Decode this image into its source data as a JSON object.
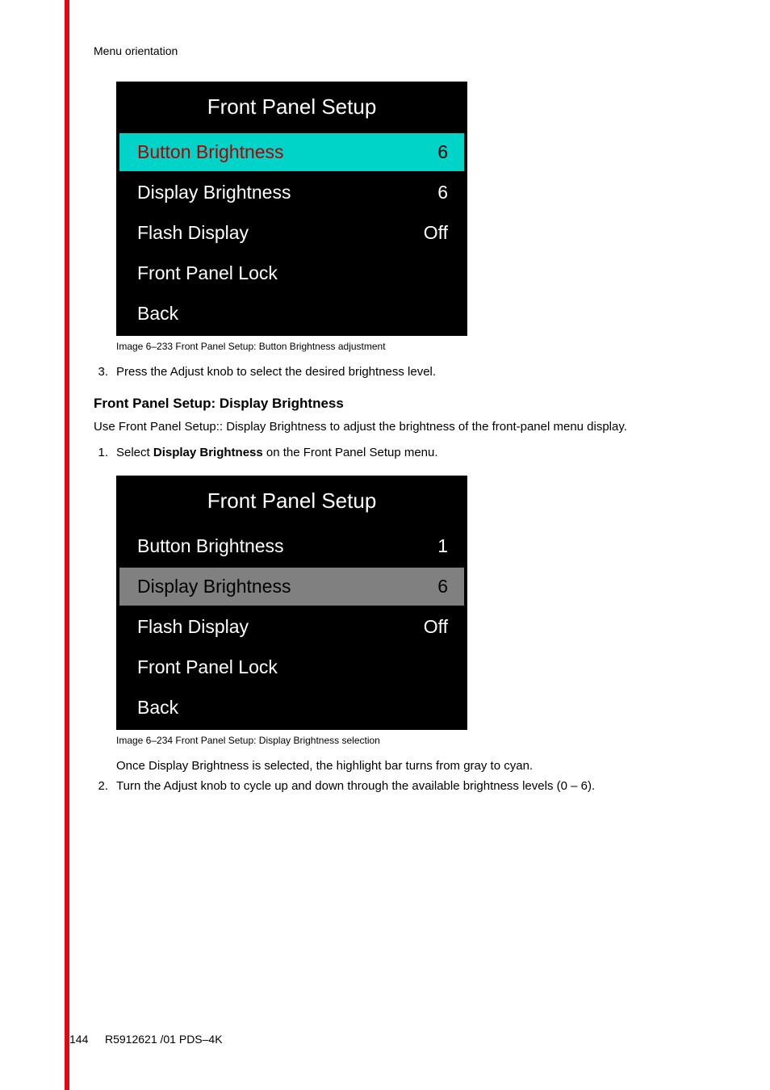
{
  "header": {
    "section_title": "Menu orientation"
  },
  "panel1": {
    "title": "Front Panel Setup",
    "rows": [
      {
        "label": "Button Brightness",
        "value": "6"
      },
      {
        "label": "Display Brightness",
        "value": "6"
      },
      {
        "label": "Flash Display",
        "value": "Off"
      },
      {
        "label": "Front Panel Lock",
        "value": ""
      },
      {
        "label": "Back",
        "value": ""
      }
    ],
    "caption": "Image 6–233  Front Panel Setup: Button Brightness adjustment"
  },
  "steps_a": {
    "num3": "3.",
    "text3": "Press the Adjust knob to select the desired brightness level."
  },
  "section2": {
    "heading": "Front Panel Setup: Display Brightness",
    "intro": "Use Front Panel Setup:: Display Brightness to adjust the brightness of the front-panel menu display."
  },
  "steps_b": {
    "num1": "1.",
    "text1_pre": "Select ",
    "text1_bold": "Display Brightness",
    "text1_post": " on the Front Panel Setup menu."
  },
  "panel2": {
    "title": "Front Panel Setup",
    "rows": [
      {
        "label": "Button Brightness",
        "value": "1"
      },
      {
        "label": "Display Brightness",
        "value": "6"
      },
      {
        "label": "Flash Display",
        "value": "Off"
      },
      {
        "label": "Front Panel Lock",
        "value": ""
      },
      {
        "label": "Back",
        "value": ""
      }
    ],
    "caption": "Image 6–234  Front Panel Setup: Display Brightness selection"
  },
  "steps_c": {
    "sub1": "Once Display Brightness is selected, the highlight bar turns from gray to cyan.",
    "num2": "2.",
    "text2": "Turn the Adjust knob to cycle up and down through the available brightness levels (0 – 6)."
  },
  "footer": {
    "page": "144",
    "docid": "R5912621 /01 PDS–4K"
  }
}
